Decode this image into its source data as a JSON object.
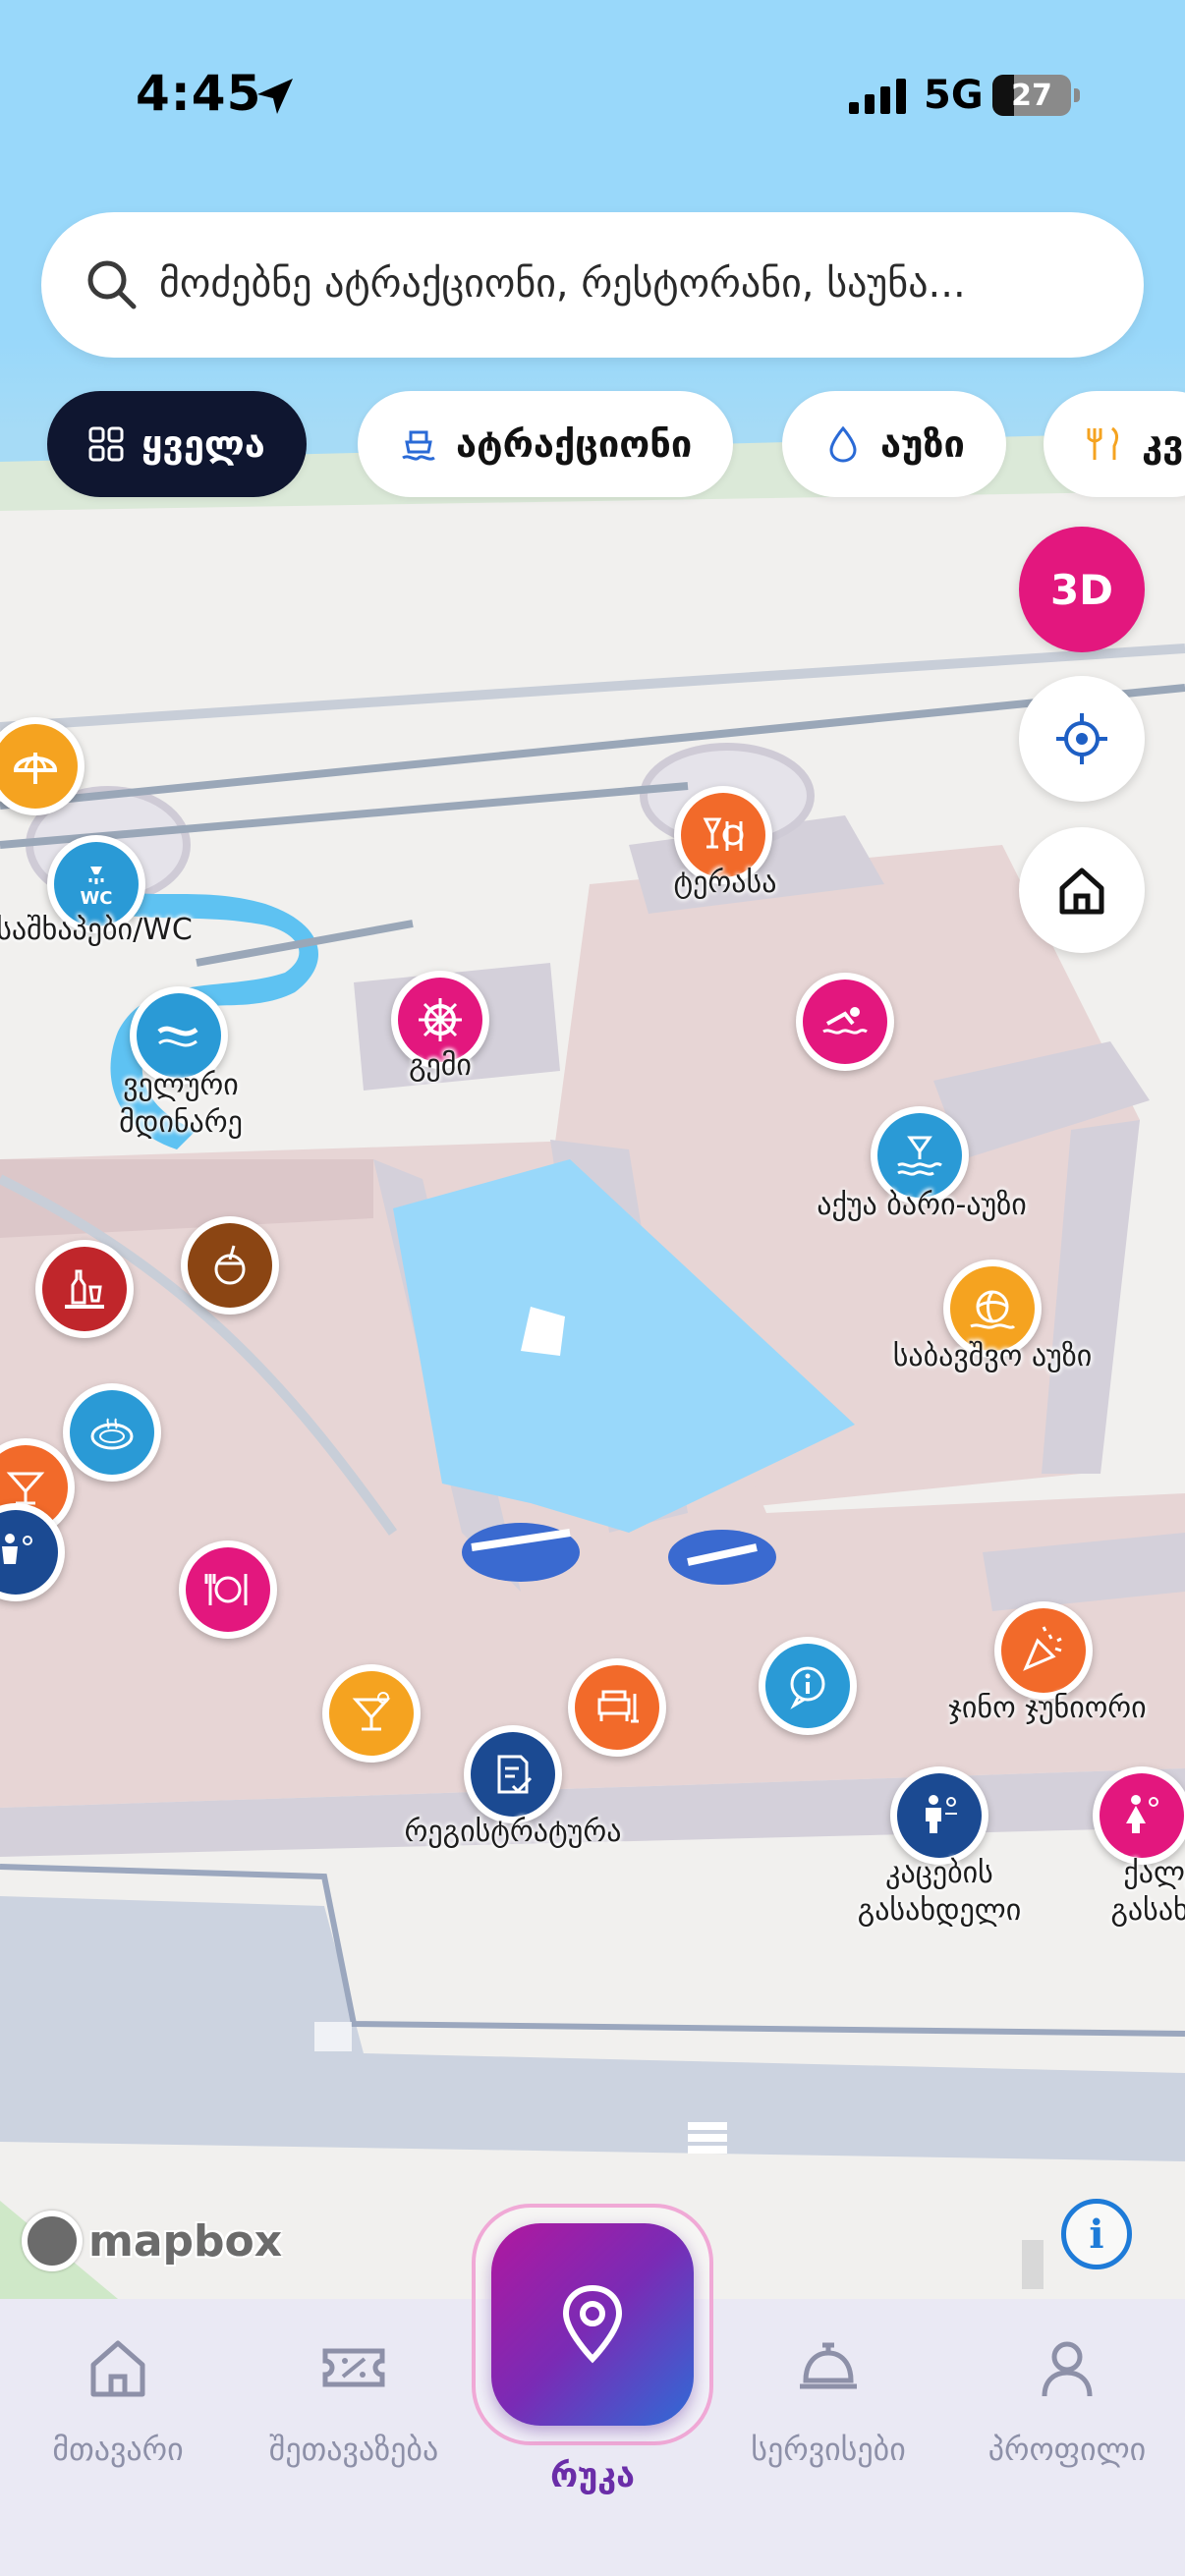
{
  "status_bar": {
    "time": "4:45",
    "network": "5G",
    "battery": "27"
  },
  "search": {
    "placeholder": "მოძებნე ატრაქციონი, რესტორანი, საუნა..."
  },
  "chips": [
    {
      "label": "ყველა",
      "icon": "grid-icon",
      "active": true
    },
    {
      "label": "ატრაქციონი",
      "icon": "boat-icon",
      "active": false
    },
    {
      "label": "აუზი",
      "icon": "water-drop-icon",
      "active": false
    },
    {
      "label": "კვ",
      "icon": "fork-knife-icon",
      "active": false
    }
  ],
  "map_controls": {
    "three_d": "3D",
    "locate_icon": "crosshair-icon",
    "home_icon": "home-icon"
  },
  "pois": [
    {
      "name": "beach-umbrella-poi",
      "label": "",
      "color": "#f5a320",
      "icon": "umbrella-icon"
    },
    {
      "name": "wc-poi",
      "label": "საშხაპები/WC",
      "color": "#2a9ad6",
      "icon": "wc-shower-icon"
    },
    {
      "name": "terrace-poi",
      "label": "ტერასა",
      "color": "#f26a2a",
      "icon": "drinks-food-icon"
    },
    {
      "name": "ship-poi",
      "label": "გემი",
      "color": "#e3177e",
      "icon": "ship-wheel-icon"
    },
    {
      "name": "swim-poi",
      "label": "",
      "color": "#e3177e",
      "icon": "swimmer-icon"
    },
    {
      "name": "wild-river-poi",
      "label": "ველური\nმდინარე",
      "color": "#2a9ad6",
      "icon": "river-icon"
    },
    {
      "name": "aqua-bar-poi",
      "label": "აქუა ბარი-აუზი",
      "color": "#2a9ad6",
      "icon": "cocktail-wave-icon"
    },
    {
      "name": "bar-poi",
      "label": "",
      "color": "#c0262b",
      "icon": "bar-bottles-icon"
    },
    {
      "name": "coconut-poi",
      "label": "",
      "color": "#8b4513",
      "icon": "coconut-icon"
    },
    {
      "name": "kids-pool-poi",
      "label": "საბავშვო აუზი",
      "color": "#f5a320",
      "icon": "beach-ball-icon"
    },
    {
      "name": "jacuzzi-poi",
      "label": "",
      "color": "#2a9ad6",
      "icon": "jacuzzi-icon"
    },
    {
      "name": "cocktail-left-poi",
      "label": "",
      "color": "#f26a2a",
      "icon": "cocktail-icon"
    },
    {
      "name": "restroom-left-poi",
      "label": "",
      "color": "#1b4a92",
      "icon": "restroom-icon"
    },
    {
      "name": "restaurant-poi",
      "label": "",
      "color": "#e3177e",
      "icon": "plate-icon"
    },
    {
      "name": "cocktail-poi",
      "label": "",
      "color": "#f5a320",
      "icon": "cocktail-icon"
    },
    {
      "name": "lounge-poi",
      "label": "",
      "color": "#f26a2a",
      "icon": "armchair-icon"
    },
    {
      "name": "info-poi",
      "label": "",
      "color": "#2a9ad6",
      "icon": "info-icon"
    },
    {
      "name": "party-poi",
      "label": "ჯინო ჯუნიორი",
      "color": "#f26a2a",
      "icon": "party-horn-icon"
    },
    {
      "name": "registration-poi",
      "label": "რეგისტრატურა",
      "color": "#1b4a92",
      "icon": "clipboard-icon"
    },
    {
      "name": "mens-changing-poi",
      "label": "კაცების\nგასახდელი",
      "color": "#1b4a92",
      "icon": "man-icon"
    },
    {
      "name": "womens-changing-poi",
      "label": "ქალებ\nგასახდე",
      "color": "#e3177e",
      "icon": "woman-icon"
    }
  ],
  "attribution": {
    "logo": "mapbox",
    "info": "i"
  },
  "nav": [
    {
      "label": "მთავარი",
      "icon": "home-icon"
    },
    {
      "label": "შეთავაზება",
      "icon": "ticket-icon"
    },
    {
      "label": "რუკა",
      "icon": "location-pin-icon"
    },
    {
      "label": "სერვისები",
      "icon": "service-bell-icon"
    },
    {
      "label": "პროფილი",
      "icon": "user-icon"
    }
  ],
  "colors": {
    "accent": "#e3177e",
    "dark_chip": "#0f1630",
    "sky": "#99d8fa",
    "water": "#99d8fa",
    "nav_active": "#6a2da8"
  }
}
